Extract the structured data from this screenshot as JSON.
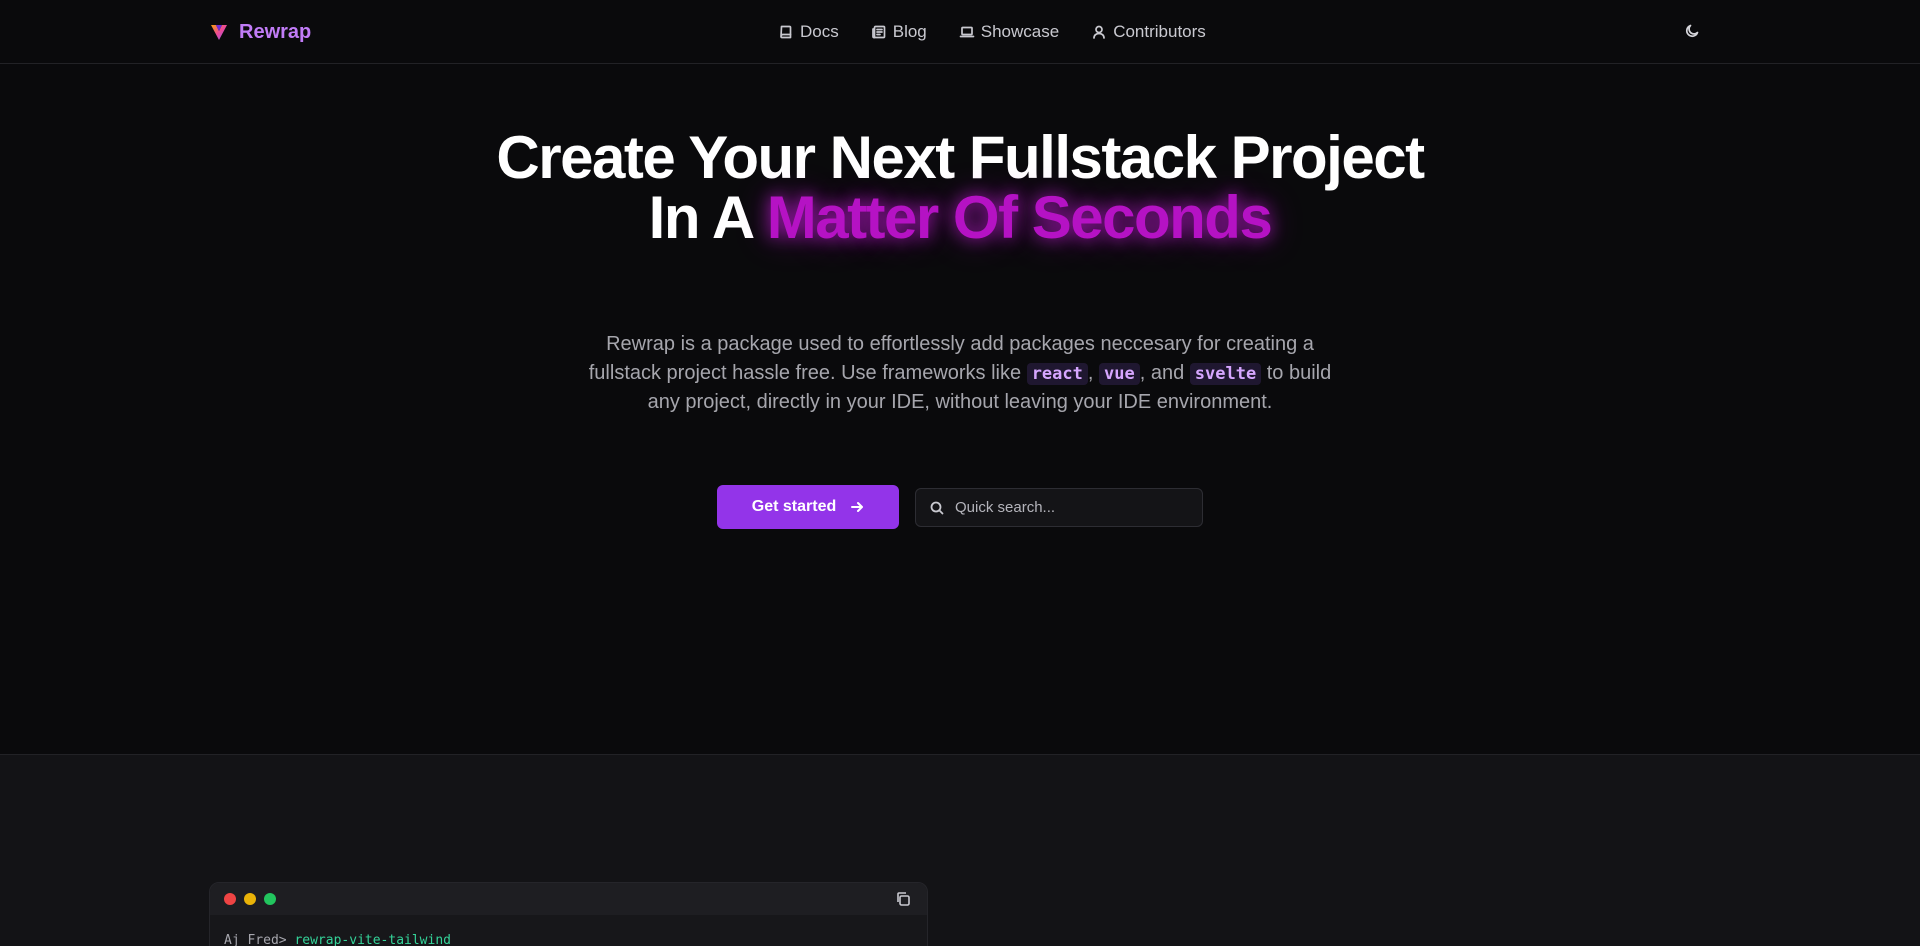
{
  "nav": {
    "brand": "Rewrap",
    "links": [
      {
        "label": "Docs",
        "icon": "book-icon"
      },
      {
        "label": "Blog",
        "icon": "newspaper-icon"
      },
      {
        "label": "Showcase",
        "icon": "laptop-icon"
      },
      {
        "label": "Contributors",
        "icon": "user-icon"
      }
    ],
    "theme_toggle_icon": "moon-icon"
  },
  "hero": {
    "headline_line1": "Create Your Next Fullstack Project",
    "headline_line2_prefix": "In A",
    "headline_accent": "Matter Of Seconds",
    "sub_part1": "Rewrap is a package used to effortlessly add packages neccesary for creating a fullstack project hassle free. Use frameworks like",
    "framework_1": "react",
    "sep_1": ",",
    "framework_2": "vue",
    "sep_2": ", and",
    "framework_3": "svelte",
    "sub_part2": "to build any project, directly in your IDE, without leaving your IDE environment.",
    "cta_label": "Get started",
    "search_placeholder": "Quick search..."
  },
  "terminal": {
    "prompt": "Aj Fred>",
    "command": "rewrap-vite-tailwind"
  },
  "colors": {
    "background": "#0a0a0c",
    "brand": "#c17cf7",
    "accent_glow": "#b512c4",
    "cta": "#9334e9",
    "code_chip_text": "#d6a6ff",
    "terminal_command": "#34d399"
  }
}
